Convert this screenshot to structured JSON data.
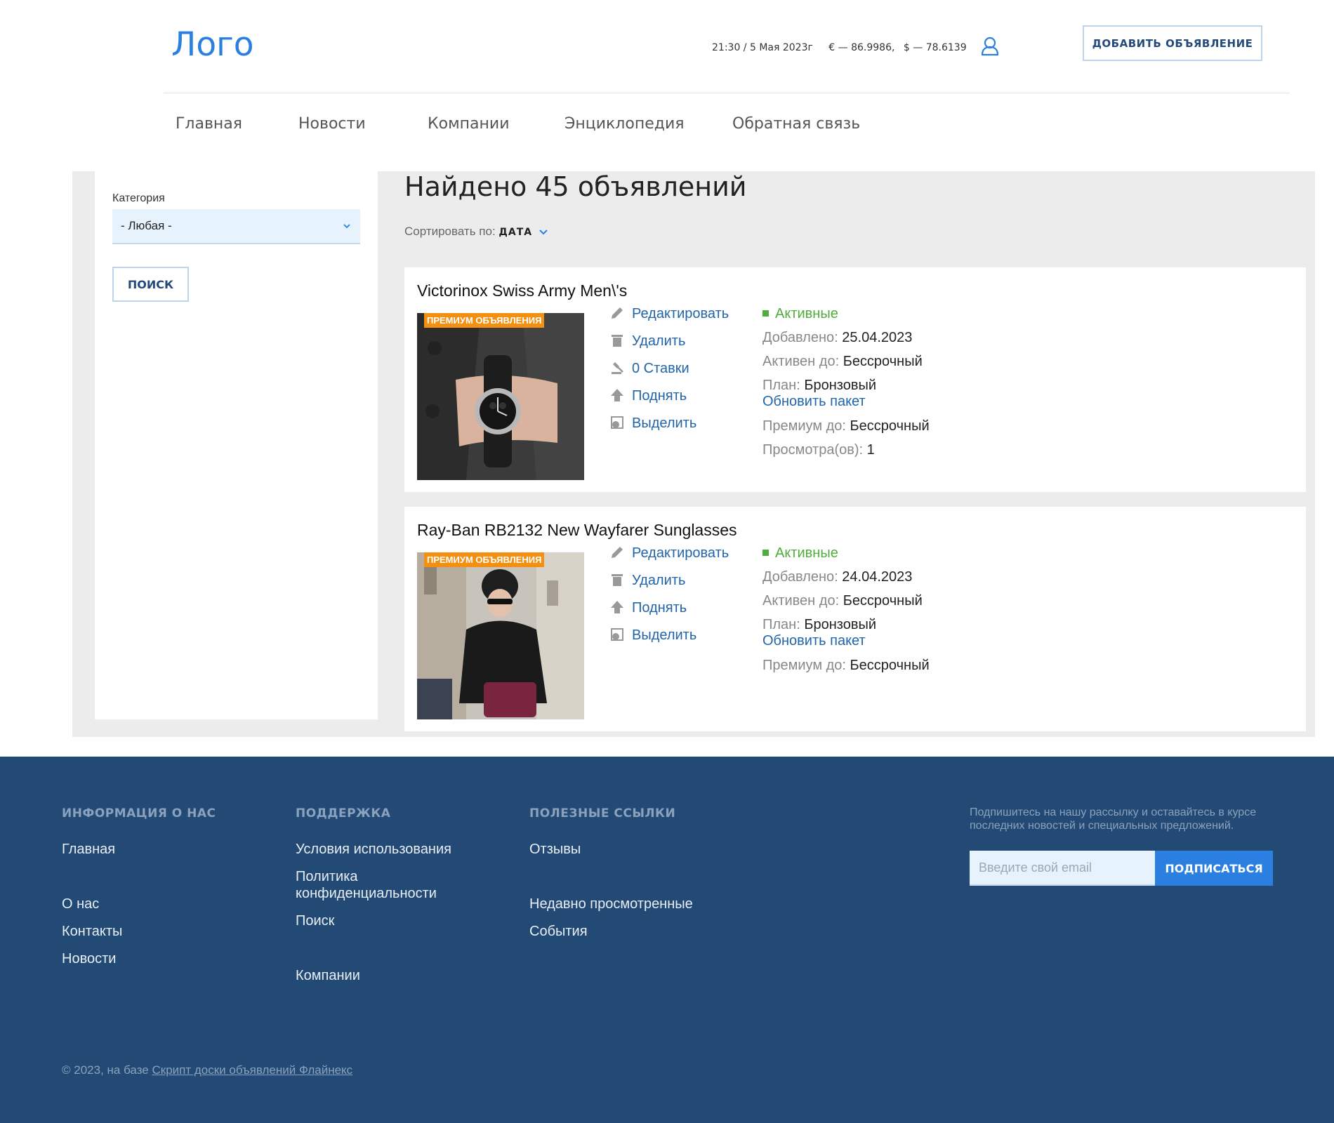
{
  "header": {
    "logo": "Лого",
    "datetime": "21:30 / 5 Мая 2023г",
    "rate_eur": "€ — 86.9986,",
    "rate_usd": "$ — 78.6139",
    "add_button": "ДОБАВИТЬ ОБЪЯВЛЕНИЕ"
  },
  "nav": [
    "Главная",
    "Новости",
    "Компании",
    "Энциклопедия",
    "Обратная связь"
  ],
  "sidebar": {
    "category_label": "Категория",
    "category_value": "- Любая -",
    "search_button": "ПОИСК"
  },
  "results": {
    "title": "Найдено 45 объявлений",
    "sort_label": "Сортировать по:",
    "sort_value": "ДАТА"
  },
  "listings": [
    {
      "title": "Victorinox Swiss Army Men\\'s",
      "badge": "ПРЕМИУМ ОБЪЯВЛЕНИЯ",
      "actions": [
        "Редактировать",
        "Удалить",
        "0 Ставки",
        "Поднять",
        "Выделить"
      ],
      "status": "Активные",
      "added_label": "Добавлено:",
      "added": "25.04.2023",
      "active_until_label": "Активен до:",
      "active_until": "Бессрочный",
      "plan_label": "План:",
      "plan": "Бронзовый",
      "upgrade": "Обновить пакет",
      "premium_until_label": "Премиум до:",
      "premium_until": "Бессрочный",
      "views_label": "Просмотра(ов):",
      "views": "1"
    },
    {
      "title": "Ray-Ban RB2132 New Wayfarer Sunglasses",
      "badge": "ПРЕМИУМ ОБЪЯВЛЕНИЯ",
      "actions": [
        "Редактировать",
        "Удалить",
        "Поднять",
        "Выделить"
      ],
      "status": "Активные",
      "added_label": "Добавлено:",
      "added": "24.04.2023",
      "active_until_label": "Активен до:",
      "active_until": "Бессрочный",
      "plan_label": "План:",
      "plan": "Бронзовый",
      "upgrade": "Обновить пакет",
      "premium_until_label": "Премиум до:",
      "premium_until": "Бессрочный"
    }
  ],
  "footer": {
    "col1": {
      "heading": "ИНФОРМАЦИЯ О НАС",
      "links": [
        "Главная",
        "О нас",
        "Контакты",
        "Новости"
      ]
    },
    "col2": {
      "heading": "ПОДДЕРЖКА",
      "links": [
        "Условия использования",
        "Политика конфиденциальности",
        "Поиск",
        "Компании"
      ]
    },
    "col3": {
      "heading": "ПОЛЕЗНЫЕ ССЫЛКИ",
      "links": [
        "Отзывы",
        "Недавно просмотренные",
        "События"
      ]
    },
    "subscribe_text": "Подпишитесь на нашу рассылку и оставайтесь в курсе последних новостей и специальных предложений.",
    "email_placeholder": "Введите свой email",
    "subscribe_button": "ПОДПИСАТЬСЯ",
    "copyright": "© 2023, на базе",
    "copyright_link": "Скрипт доски объявлений Флайнекс"
  },
  "colors": {
    "accent": "#2b7fe0",
    "footer_bg": "#234a75",
    "badge": "#f39012",
    "status_active": "#4fae3b",
    "link": "#2165a8"
  }
}
